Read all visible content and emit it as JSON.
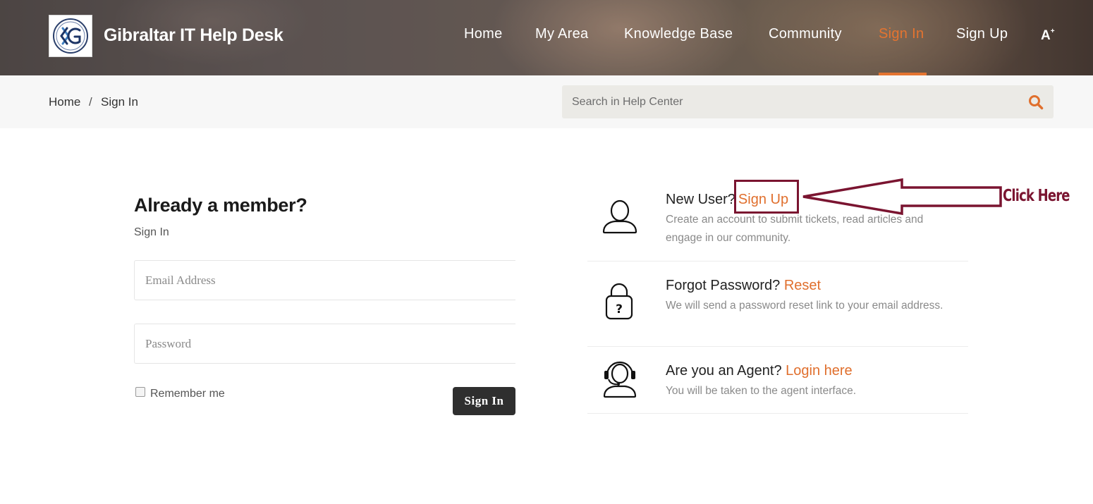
{
  "header": {
    "brand": "Gibraltar IT Help Desk",
    "nav": [
      {
        "label": "Home",
        "active": false
      },
      {
        "label": "My Area",
        "active": false
      },
      {
        "label": "Knowledge Base",
        "active": false
      },
      {
        "label": "Community",
        "active": false
      },
      {
        "label": "Sign In",
        "active": true
      },
      {
        "label": "Sign Up",
        "active": false
      }
    ],
    "accessibility_label": "A",
    "accessibility_sup": "+"
  },
  "breadcrumb": {
    "items": [
      "Home",
      "Sign In"
    ],
    "separator": "/"
  },
  "search": {
    "placeholder": "Search in Help Center",
    "icon": "search-icon"
  },
  "login": {
    "title": "Already a member?",
    "subtitle": "Sign In",
    "email_placeholder": "Email Address",
    "password_placeholder": "Password",
    "remember_label": "Remember me",
    "submit_label": "Sign In"
  },
  "info": [
    {
      "icon": "user-icon",
      "prefix": "New User?",
      "link": "Sign Up",
      "description": "Create an account to submit tickets, read articles and engage in our community."
    },
    {
      "icon": "lock-question-icon",
      "prefix": "Forgot Password?",
      "link": "Reset",
      "description": "We will send a password reset link to your email address."
    },
    {
      "icon": "headset-agent-icon",
      "prefix": "Are you an Agent?",
      "link": "Login here",
      "description": "You will be taken to the agent interface."
    }
  ],
  "annotation": {
    "text": "Click Here",
    "color": "#7a1430"
  },
  "colors": {
    "accent": "#e06f2d",
    "button": "#2f2f2f"
  }
}
